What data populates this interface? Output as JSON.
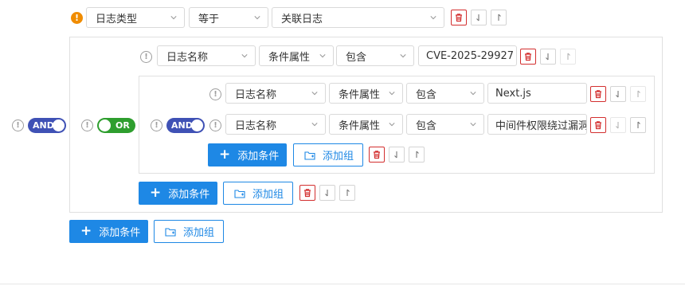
{
  "root": {
    "toggle": "AND",
    "add_condition": "添加条件",
    "add_group": "添加组",
    "condition": {
      "field": "日志类型",
      "operator": "等于",
      "value": "关联日志"
    }
  },
  "group1": {
    "toggle": "OR",
    "add_condition": "添加条件",
    "add_group": "添加组",
    "condition": {
      "field": "日志名称",
      "attr": "条件属性",
      "operator": "包含",
      "value": "CVE-2025-29927"
    }
  },
  "group2": {
    "toggle": "AND",
    "add_condition": "添加条件",
    "add_group": "添加组",
    "conditions": [
      {
        "field": "日志名称",
        "attr": "条件属性",
        "operator": "包含",
        "value": "Next.js"
      },
      {
        "field": "日志名称",
        "attr": "条件属性",
        "operator": "包含",
        "value": "中间件权限绕过漏洞"
      }
    ]
  },
  "icons": {
    "warn": "!",
    "info": "!",
    "move_down": "↓",
    "move_up": "↑"
  },
  "colors": {
    "primary": "#1e88e5",
    "and_toggle": "#3f51b5",
    "or_toggle": "#2e9e2e",
    "delete": "#d32f2f",
    "warning": "#f08c00"
  }
}
